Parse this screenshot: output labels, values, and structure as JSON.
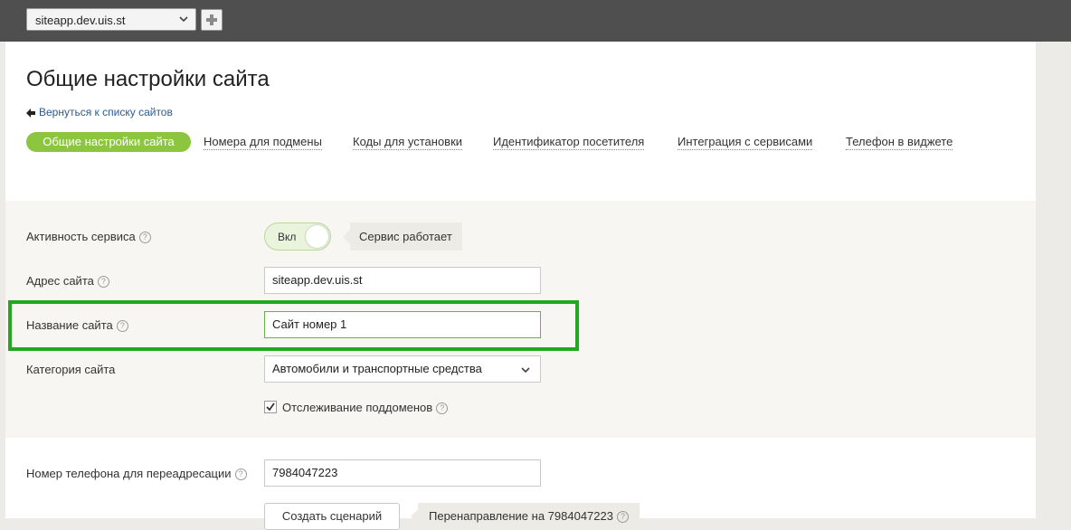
{
  "topbar": {
    "site_select_value": "siteapp.dev.uis.st"
  },
  "page": {
    "title": "Общие настройки сайта",
    "back_link": "Вернуться к списку сайтов"
  },
  "tabs": [
    {
      "label": "Общие настройки сайта",
      "active": true
    },
    {
      "label": "Номера для подмены",
      "active": false
    },
    {
      "label": "Коды для установки",
      "active": false
    },
    {
      "label": "Идентификатор посетителя",
      "active": false
    },
    {
      "label": "Интеграция с сервисами",
      "active": false
    },
    {
      "label": "Телефон в виджете",
      "active": false
    }
  ],
  "form": {
    "service_activity": {
      "label": "Активность сервиса",
      "toggle_label": "Вкл",
      "status": "Сервис работает"
    },
    "site_address": {
      "label": "Адрес сайта",
      "value": "siteapp.dev.uis.st"
    },
    "site_name": {
      "label": "Название сайта",
      "value": "Сайт номер 1"
    },
    "site_category": {
      "label": "Категория сайта",
      "value": "Автомобили и транспортные средства"
    },
    "subdomain_tracking": {
      "label": "Отслеживание поддоменов",
      "checked": true
    }
  },
  "redirect": {
    "label": "Номер телефона для переадресации",
    "value": "7984047223",
    "create_button": "Создать сценарий",
    "hint": "Перенаправление на 7984047223"
  },
  "help_glyph": "?",
  "colors": {
    "accent_green": "#8cc63f",
    "highlight": "#20a820",
    "link": "#2b5c92",
    "topbar": "#4f4f4f"
  }
}
